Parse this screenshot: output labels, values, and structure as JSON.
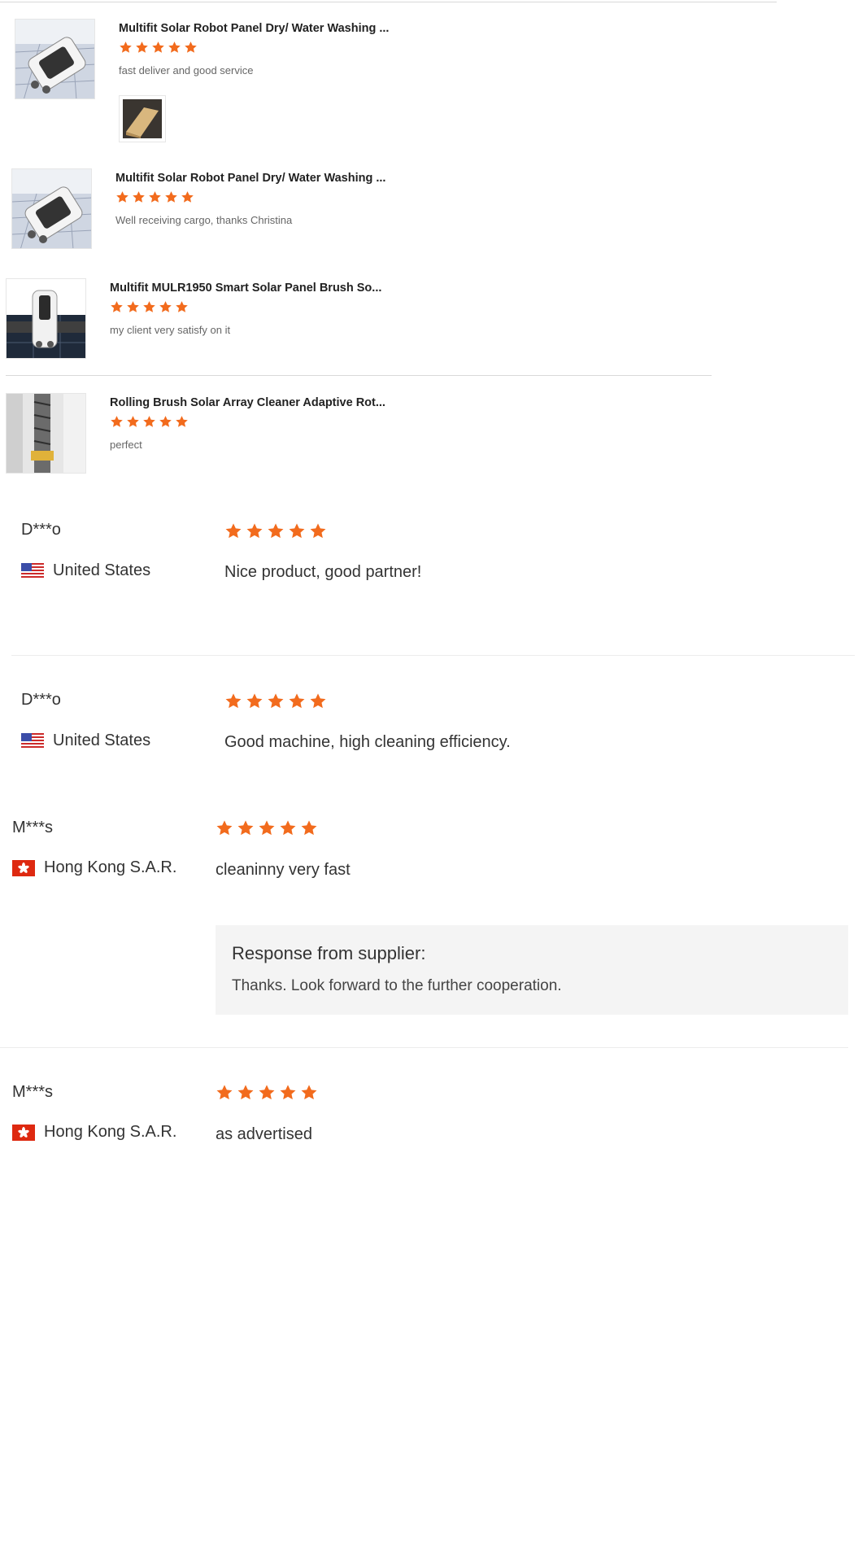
{
  "product_reviews": [
    {
      "title": "Multifit Solar Robot Panel Dry/ Water Washing ...",
      "rating": 5,
      "comment": "fast deliver and good service",
      "thumb_icon": "solar-robot-photo",
      "has_attachment": true,
      "attachment_icon": "package-box-photo"
    },
    {
      "title": "Multifit Solar Robot Panel Dry/ Water Washing ...",
      "rating": 5,
      "comment": "Well receiving cargo, thanks Christina",
      "thumb_icon": "solar-robot-photo"
    },
    {
      "title": "Multifit MULR1950 Smart Solar Panel Brush So...",
      "rating": 5,
      "comment": "my client very satisfy on it",
      "thumb_icon": "solar-brush-robot-photo"
    },
    {
      "title": "Rolling Brush Solar Array Cleaner Adaptive Rot...",
      "rating": 5,
      "comment": "perfect",
      "thumb_icon": "rolling-brush-photo"
    }
  ],
  "buyer_reviews": [
    {
      "buyer": "D***o",
      "country": "United States",
      "flag_icon": "us-flag-icon",
      "rating": 5,
      "comment": "Nice product, good partner!"
    },
    {
      "buyer": "D***o",
      "country": "United States",
      "flag_icon": "us-flag-icon",
      "rating": 5,
      "comment": "Good machine, high cleaning efficiency."
    },
    {
      "buyer": "M***s",
      "country": "Hong Kong S.A.R.",
      "flag_icon": "hk-flag-icon",
      "rating": 5,
      "comment": "cleaninny very fast",
      "supplier_response": {
        "heading": "Response from supplier:",
        "text": "Thanks. Look forward to the further cooperation."
      }
    },
    {
      "buyer": "M***s",
      "country": "Hong Kong S.A.R.",
      "flag_icon": "hk-flag-icon",
      "rating": 5,
      "comment": "as advertised"
    }
  ],
  "colors": {
    "star": "#f26b1d",
    "text": "#333333",
    "muted": "#666666",
    "response_bg": "#f4f4f4"
  }
}
